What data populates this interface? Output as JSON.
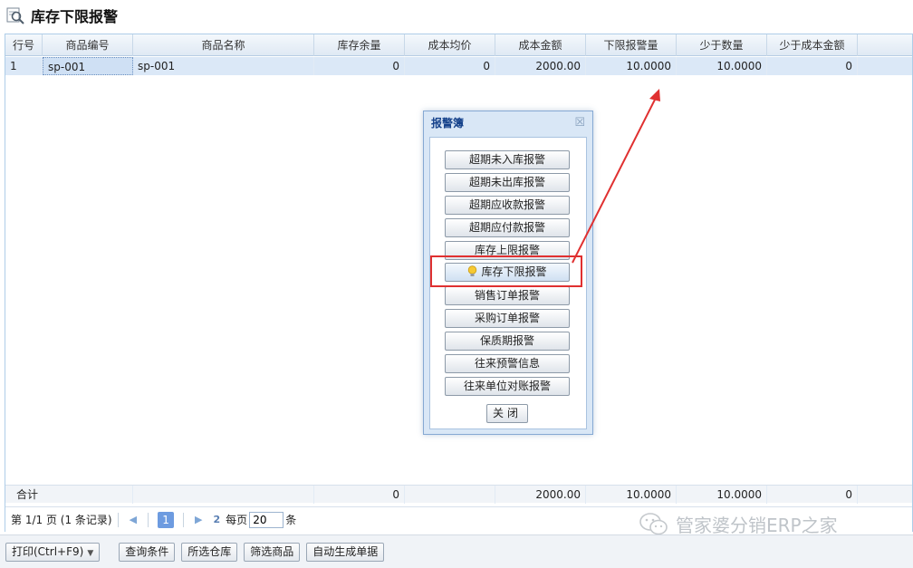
{
  "window": {
    "title": "库存下限报警",
    "icon": "search-doc-icon"
  },
  "grid": {
    "columns": [
      "行号",
      "商品编号",
      "商品名称",
      "库存余量",
      "成本均价",
      "成本金额",
      "下限报警量",
      "少于数量",
      "少于成本金额"
    ],
    "rows": [
      {
        "row_no": "1",
        "code": "sp-001",
        "name": "sp-001",
        "stock": "0",
        "avg_cost": "0",
        "cost_amount": "2000.00",
        "min_alert": "10.0000",
        "short_qty": "10.0000",
        "short_cost": "0"
      }
    ],
    "summary": {
      "label": "合计",
      "stock": "0",
      "cost_amount": "2000.00",
      "min_alert": "10.0000",
      "short_qty": "10.0000",
      "short_cost": "0"
    }
  },
  "pager": {
    "page_info": "第 1/1 页 (1 条记录)",
    "current_page": "1",
    "refresh_label": "2",
    "page_size_label": "每页",
    "page_size": "20",
    "unit": "条"
  },
  "toolbar": {
    "print": "打印(Ctrl+F9)",
    "query": "查询条件",
    "warehouse": "所选仓库",
    "filter": "筛选商品",
    "auto_gen": "自动生成单据"
  },
  "dialog": {
    "title": "报警簿",
    "close_x": "☒",
    "buttons": [
      "超期未入库报警",
      "超期未出库报警",
      "超期应收款报警",
      "超期应付款报警",
      "库存上限报警",
      "库存下限报警",
      "销售订单报警",
      "采购订单报警",
      "保质期报警",
      "往来预警信息",
      "往来单位对账报警"
    ],
    "active_index": 5,
    "close_label": "关闭"
  },
  "watermark": {
    "text": "管家婆分销ERP之家"
  },
  "colors": {
    "highlight": "#e03030",
    "selected_row": "#dbe8f7",
    "dialog_title": "#15428b"
  }
}
